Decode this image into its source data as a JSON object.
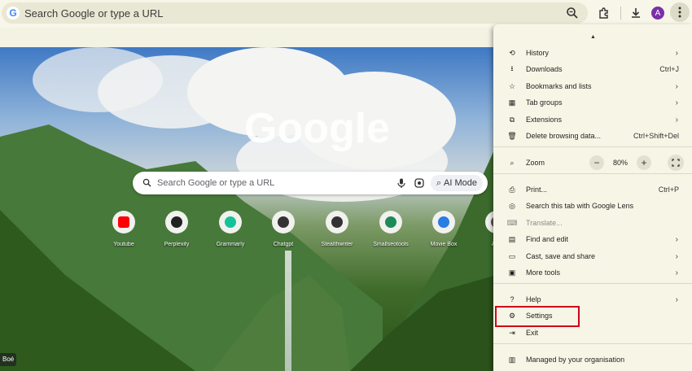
{
  "toolbar": {
    "omnibox_placeholder": "Search Google or type a URL",
    "avatar_letter": "A"
  },
  "ntp": {
    "logo_text": "Google",
    "search_placeholder": "Search Google or type a URL",
    "ai_mode_label": "AI Mode",
    "shortcuts": [
      {
        "label": "Youtube",
        "icon": "youtube-icon"
      },
      {
        "label": "Perplexity",
        "icon": "perplexity-icon"
      },
      {
        "label": "Grammarly",
        "icon": "grammarly-icon"
      },
      {
        "label": "Chatgpt",
        "icon": "chatgpt-icon"
      },
      {
        "label": "Stealthwriter",
        "icon": "stealthwriter-icon"
      },
      {
        "label": "Smallseotools",
        "icon": "smallseotools-icon"
      },
      {
        "label": "Movie Box",
        "icon": "moviebox-icon"
      },
      {
        "label": "Add",
        "icon": "add-shortcut-icon"
      }
    ],
    "bottom_tag": "Boé"
  },
  "menu": {
    "items": [
      {
        "label": "History",
        "shortcut": "",
        "chevron": true,
        "icon": "history-icon"
      },
      {
        "label": "Downloads",
        "shortcut": "Ctrl+J",
        "chevron": false,
        "icon": "download-icon"
      },
      {
        "label": "Bookmarks and lists",
        "shortcut": "",
        "chevron": true,
        "icon": "star-icon"
      },
      {
        "label": "Tab groups",
        "shortcut": "",
        "chevron": true,
        "icon": "tab-groups-icon"
      },
      {
        "label": "Extensions",
        "shortcut": "",
        "chevron": true,
        "icon": "extensions-icon"
      },
      {
        "label": "Delete browsing data...",
        "shortcut": "Ctrl+Shift+Del",
        "chevron": false,
        "icon": "trash-icon"
      }
    ],
    "zoom": {
      "label": "Zoom",
      "value": "80%",
      "minus": "−",
      "plus": "+"
    },
    "items2": [
      {
        "label": "Print...",
        "shortcut": "Ctrl+P",
        "chevron": false,
        "icon": "print-icon"
      },
      {
        "label": "Search this tab with Google Lens",
        "shortcut": "",
        "chevron": false,
        "icon": "lens-icon"
      },
      {
        "label": "Translate...",
        "shortcut": "",
        "chevron": false,
        "icon": "translate-icon",
        "disabled": true
      },
      {
        "label": "Find and edit",
        "shortcut": "",
        "chevron": true,
        "icon": "find-icon"
      },
      {
        "label": "Cast, save and share",
        "shortcut": "",
        "chevron": true,
        "icon": "cast-icon"
      },
      {
        "label": "More tools",
        "shortcut": "",
        "chevron": true,
        "icon": "tools-icon"
      }
    ],
    "items3": [
      {
        "label": "Help",
        "shortcut": "",
        "chevron": true,
        "icon": "help-icon"
      },
      {
        "label": "Settings",
        "shortcut": "",
        "chevron": false,
        "icon": "gear-icon"
      },
      {
        "label": "Exit",
        "shortcut": "",
        "chevron": false,
        "icon": "exit-icon"
      }
    ],
    "managed": {
      "label": "Managed by your organisation",
      "icon": "building-icon"
    }
  },
  "colors": {
    "highlight": "#d0021b",
    "menu_bg": "#f7f6e6",
    "avatar": "#7b2fa8"
  }
}
